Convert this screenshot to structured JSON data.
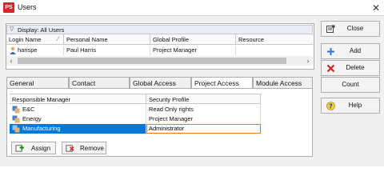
{
  "window": {
    "title": "Users",
    "app_icon": "PS"
  },
  "display": {
    "label": "Display: All Users"
  },
  "users_grid": {
    "columns": [
      "Login Name",
      "Personal Name",
      "Global Profile",
      "Resource"
    ],
    "rows": [
      {
        "login": "harispe",
        "personal_name": "Paul Harris",
        "global_profile": "Project Manager",
        "resource": ""
      }
    ]
  },
  "tabs": [
    "General",
    "Contact",
    "Global Access",
    "Project Access",
    "Module Access"
  ],
  "active_tab": "Project Access",
  "access_grid": {
    "columns": [
      "Responsible Manager",
      "Security Profile"
    ],
    "rows": [
      {
        "manager": "E&C",
        "profile": "Read Only rights"
      },
      {
        "manager": "Energy",
        "profile": "Project Manager"
      },
      {
        "manager": "Manufacturing",
        "profile": "Administrator"
      }
    ],
    "selected_index": 2
  },
  "bottom_buttons": {
    "assign": "Assign",
    "remove": "Remove"
  },
  "side_buttons": {
    "close": "Close",
    "add": "Add",
    "delete": "Delete",
    "count": "Count",
    "help": "Help"
  },
  "colors": {
    "selection": "#0078d7",
    "focus_border": "#e07b24",
    "app_icon": "#d8232a"
  }
}
